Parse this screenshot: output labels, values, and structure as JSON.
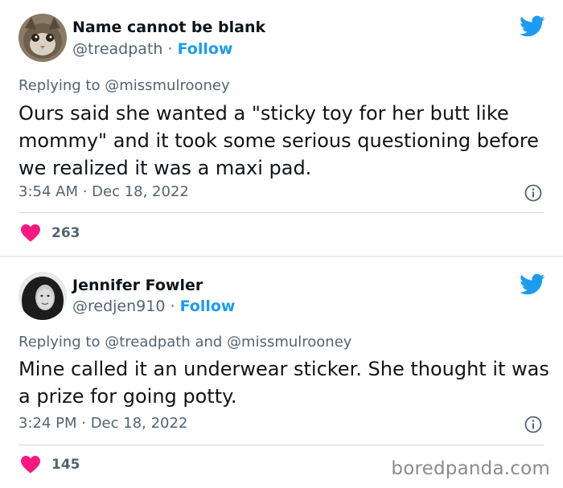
{
  "tweets": [
    {
      "name": "Name cannot be blank",
      "handle": "@treadpath",
      "separator": "·",
      "follow_label": "Follow",
      "replying_prefix": "Replying to",
      "replying_to": "@missmulrooney",
      "body": "Ours said she wanted a \"sticky toy for her butt like mommy\" and it took some serious questioning before we realized it was a maxi pad.",
      "time": "3:54 AM · Dec 18, 2022",
      "likes": "263"
    },
    {
      "name": "Jennifer Fowler",
      "handle": "@redjen910",
      "separator": "·",
      "follow_label": "Follow",
      "replying_prefix": "Replying to",
      "replying_to": "@treadpath and @missmulrooney",
      "body": "Mine called it an underwear sticker. She thought it was a prize for going potty.",
      "time": "3:24 PM · Dec 18, 2022",
      "likes": "145"
    }
  ],
  "watermark": "boredpanda.com",
  "colors": {
    "twitter_blue": "#1d9bf0",
    "heart_pink": "#f91880",
    "secondary_text": "#536471"
  },
  "icons": [
    "twitter-bird-icon",
    "info-icon",
    "heart-icon"
  ]
}
